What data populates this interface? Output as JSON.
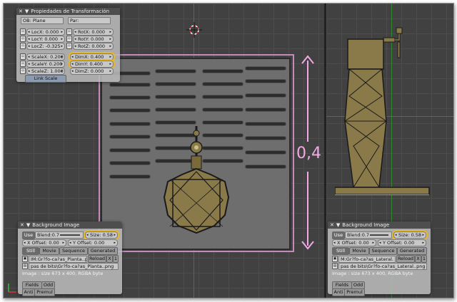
{
  "colors": {
    "highlight": "#e8b828",
    "dimension": "#f2a9e6",
    "grid": "#414141",
    "bronze": "#8a7a4a"
  },
  "transform_panel": {
    "title": "Propiedades de Transformación",
    "ob_label": "OB: Plane",
    "par_label": "Par:",
    "loc": [
      {
        "label": "LocX:",
        "value": "0.000"
      },
      {
        "label": "LocY:",
        "value": "0.000"
      },
      {
        "label": "LocZ:",
        "value": "-0.325"
      }
    ],
    "rot": [
      {
        "label": "RotX:",
        "value": "0.000"
      },
      {
        "label": "RotY:",
        "value": "0.000"
      },
      {
        "label": "RotZ:",
        "value": "0.000"
      }
    ],
    "scale": [
      {
        "label": "ScaleX:",
        "value": "0.200"
      },
      {
        "label": "ScaleY:",
        "value": "0.200"
      },
      {
        "label": "ScaleZ:",
        "value": "1.000"
      }
    ],
    "dim": [
      {
        "label": "DimX:",
        "value": "0.400"
      },
      {
        "label": "DimY:",
        "value": "0.400"
      },
      {
        "label": "DimZ:",
        "value": "0.000"
      }
    ],
    "link_scale": "Link Scale"
  },
  "dimension_label": "0,4",
  "bg_left": {
    "title": "Background Image",
    "use": "Use",
    "blend": "Blend:0.7",
    "size": "Size: 0.58",
    "x_offset": "X Offset: 0.00",
    "y_offset": "Y Offset: 0.00",
    "tabs": [
      "Still",
      "Movie",
      "Sequence",
      "Generated"
    ],
    "image_name": "IM:Gr?fo-ca?as_Planta..p",
    "reload": "Reload",
    "close": "X",
    "users": "1",
    "path": "pas de bits\\Gr?fo-ca?as_Planta..png",
    "info": "Image : size 673 x 400, RGBA byte",
    "fields": "Fields",
    "odd": "Odd",
    "anti": "Anti",
    "premul": "Premul"
  },
  "bg_right": {
    "title": "Background Image",
    "use": "Use",
    "blend": "Blend:0.7",
    "size": "Size: 0.58",
    "x_offset": "X Offset: 0.00",
    "y_offset": "Y Offset: 0.00",
    "tabs": [
      "Still",
      "Movie",
      "Sequence",
      "Generated"
    ],
    "image_name": "M:Gr?fo-ca?as_Lateral.",
    "reload": "Reload",
    "close": "X",
    "users": "1",
    "path": "pas de bits\\Gr?fo-ca?as_Lateral..png",
    "info": "Image : size 673 x 400, RGBA byte",
    "fields": "Fields",
    "odd": "Odd",
    "anti": "Anti",
    "premul": "Premul"
  }
}
